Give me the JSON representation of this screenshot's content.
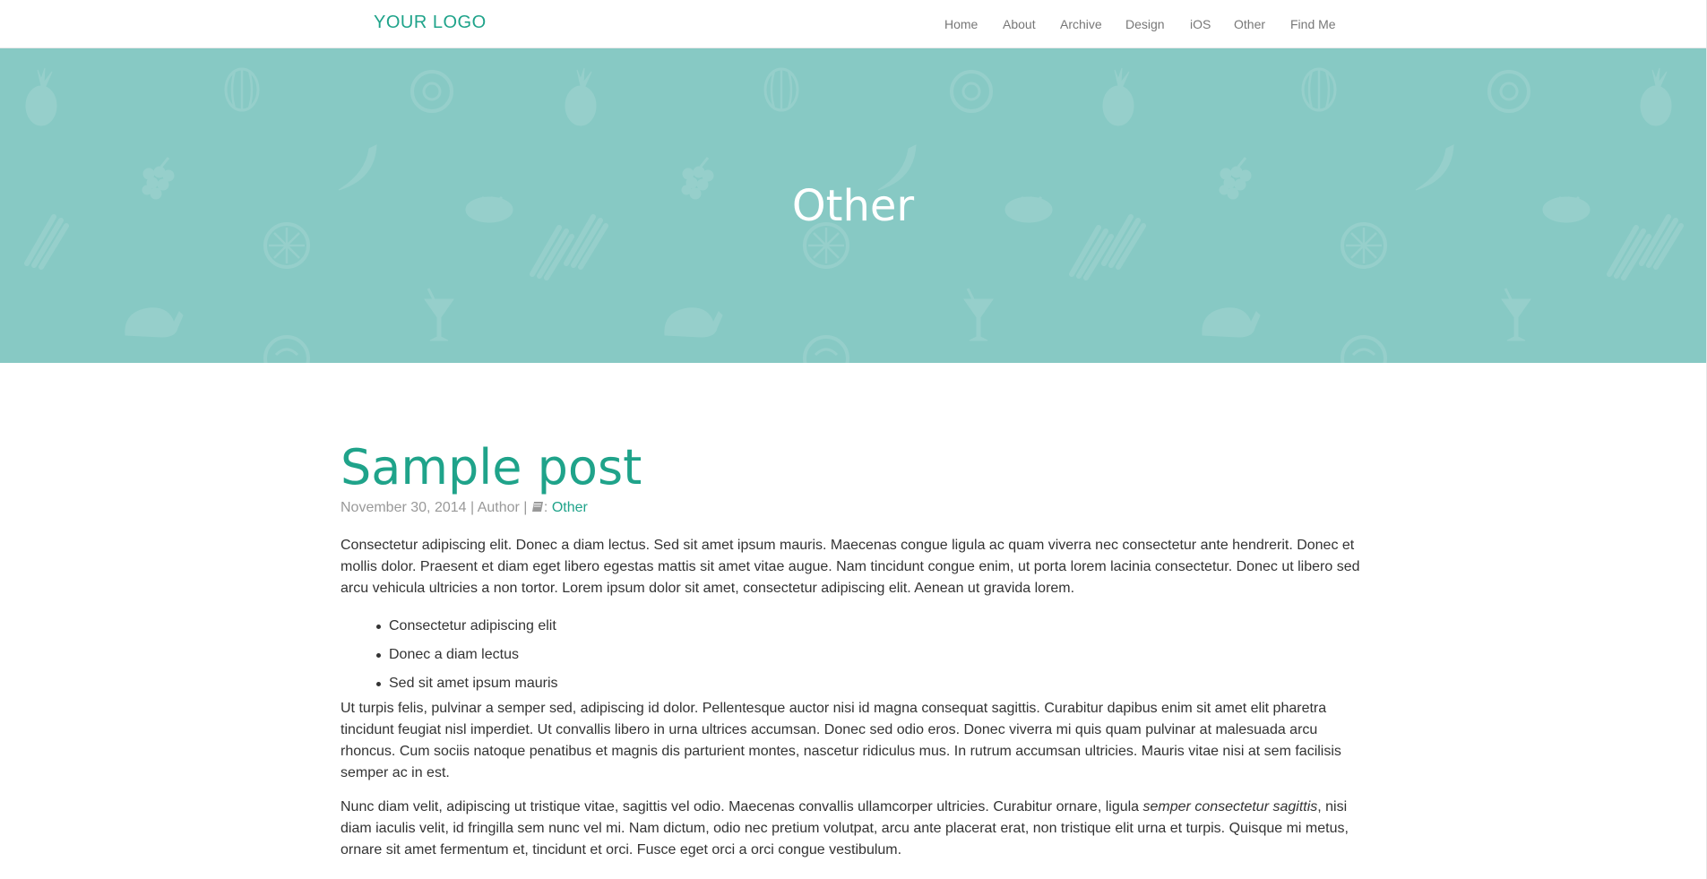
{
  "header": {
    "logo": "YOUR LOGO",
    "nav": [
      "Home",
      "About",
      "Archive",
      "Design",
      "iOS",
      "Other",
      "Find Me"
    ]
  },
  "hero": {
    "title": "Other",
    "background_color": "#87c9c4",
    "pattern_icons": [
      "pineapple-icon",
      "watermelon-icon",
      "donut-icon",
      "banana-icon",
      "grapes-icon",
      "bread-icon",
      "celery-icon",
      "orange-slice-icon",
      "roast-chicken-icon",
      "cocktail-icon",
      "lime-icon"
    ]
  },
  "post": {
    "title": "Sample post",
    "date": "November 30, 2014",
    "separator": "|",
    "author": "Author",
    "category_suffix": ":",
    "category": "Other",
    "paragraph_1": "Consectetur adipiscing elit. Donec a diam lectus. Sed sit amet ipsum mauris. Maecenas congue ligula ac quam viverra nec consectetur ante hendrerit. Donec et mollis dolor. Praesent et diam eget libero egestas mattis sit amet vitae augue. Nam tincidunt congue enim, ut porta lorem lacinia consectetur. Donec ut libero sed arcu vehicula ultricies a non tortor. Lorem ipsum dolor sit amet, consectetur adipiscing elit. Aenean ut gravida lorem.",
    "bullets": [
      "Consectetur adipiscing elit",
      "Donec a diam lectus",
      "Sed sit amet ipsum mauris"
    ],
    "paragraph_2": "Ut turpis felis, pulvinar a semper sed, adipiscing id dolor. Pellentesque auctor nisi id magna consequat sagittis. Curabitur dapibus enim sit amet elit pharetra tincidunt feugiat nisl imperdiet. Ut convallis libero in urna ultrices accumsan. Donec sed odio eros. Donec viverra mi quis quam pulvinar at malesuada arcu rhoncus. Cum sociis natoque penatibus et magnis dis parturient montes, nascetur ridiculus mus. In rutrum accumsan ultricies. Mauris vitae nisi at sem facilisis semper ac in est.",
    "paragraph_3_before": "Nunc diam velit, adipiscing ut tristique vitae, sagittis vel odio. Maecenas convallis ullamcorper ultricies. Curabitur ornare, ligula ",
    "paragraph_3_italic": "semper consectetur sagittis",
    "paragraph_3_after": ", nisi diam iaculis velit, id fringilla sem nunc vel mi. Nam dictum, odio nec pretium volutpat, arcu ante placerat erat, non tristique elit urna et turpis. Quisque mi metus, ornare sit amet fermentum et, tincidunt et orci. Fusce eget orci a orci congue vestibulum."
  },
  "colors": {
    "accent": "#1fa38a",
    "hero_bg": "#87c9c4",
    "nav_text": "#777777",
    "meta_text": "#999999",
    "body_text": "#333333"
  }
}
